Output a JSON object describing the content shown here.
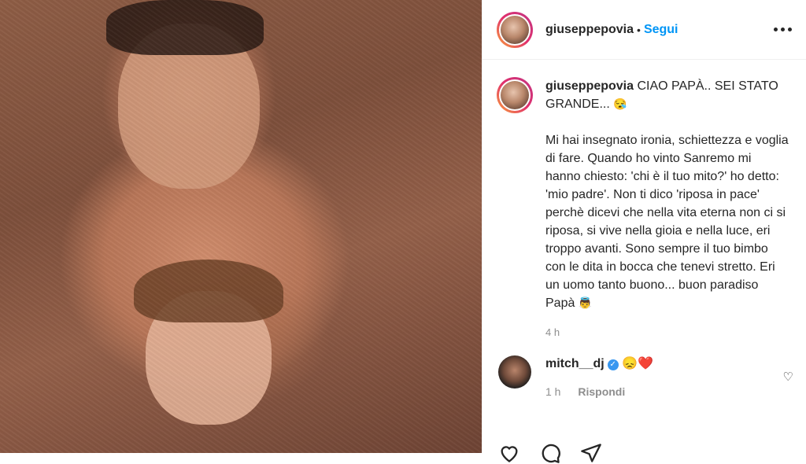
{
  "post": {
    "username": "giuseppepovia",
    "follow_label": "Segui",
    "separator": "•"
  },
  "caption": {
    "username": "giuseppepovia",
    "headline": "CIAO PAPÀ.. SEI STATO GRANDE...",
    "headline_emoji": "😪",
    "body": "Mi hai insegnato ironia, schiettezza e voglia di fare. Quando ho vinto Sanremo mi hanno chiesto: 'chi è il tuo mito?' ho detto: 'mio padre'. Non ti dico 'riposa in pace' perchè dicevi che nella vita eterna non ci si riposa, si vive nella gioia e nella luce, eri troppo avanti. Sono sempre il tuo bimbo con le dita in bocca che tenevi stretto. Eri un uomo tanto buono... buon paradiso Papà",
    "body_emoji": "👼",
    "time": "4 h"
  },
  "comment": {
    "username": "mitch__dj",
    "verified_mark": "✓",
    "text": "😞❤️",
    "time": "1 h",
    "reply_label": "Rispondi",
    "like_icon": "♡"
  },
  "colors": {
    "accent": "#0095f6",
    "verified": "#3897f0"
  }
}
